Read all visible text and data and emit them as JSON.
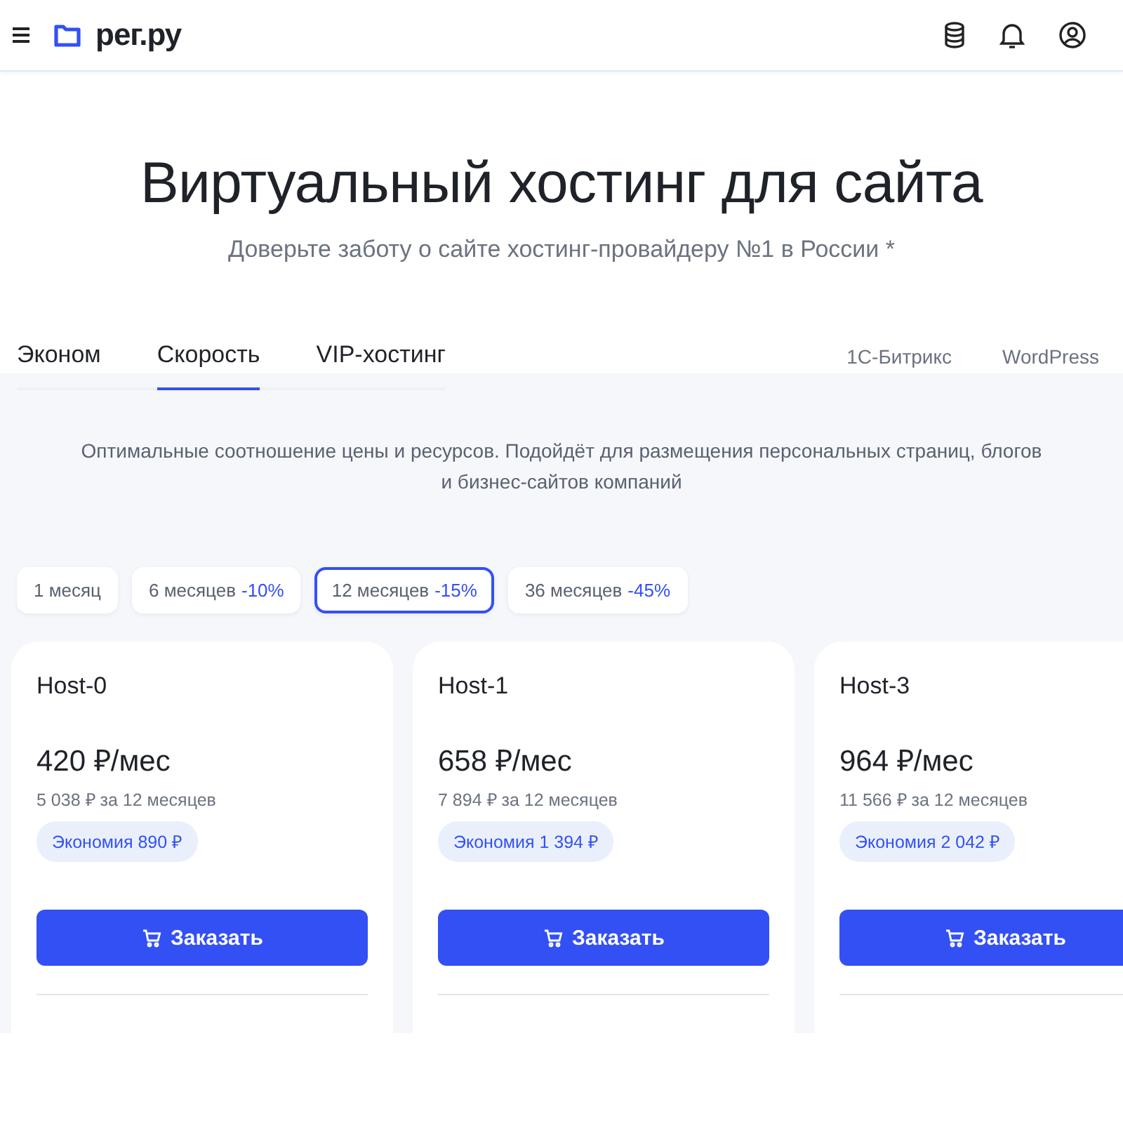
{
  "header": {
    "logo": "рег.ру"
  },
  "hero": {
    "title": "Виртуальный хостинг для сайта",
    "subtitle": "Доверьте заботу о сайте хостинг-провайдеру №1 в России *"
  },
  "tabs": [
    {
      "label": "Эконом",
      "selected": false
    },
    {
      "label": "Скорость",
      "selected": true
    },
    {
      "label": "VIP-хостинг",
      "selected": false
    }
  ],
  "side_links": [
    "1С-Битрикс",
    "WordPress"
  ],
  "description": [
    "Оптимальные соотношение цены и ресурсов. Подойдёт для размещения персональных страниц, блогов",
    "и бизнес-сайтов компаний"
  ],
  "periods": [
    {
      "label": "1 месяц",
      "selected": false
    },
    {
      "label": "6 месяцев",
      "discount": "-10%",
      "selected": false
    },
    {
      "label": "12 месяцев",
      "discount": "-15%",
      "selected": true
    },
    {
      "label": "36 месяцев",
      "discount": "-45%",
      "selected": false
    }
  ],
  "plans": [
    {
      "name": "Host-0",
      "price": "420 ₽/мес",
      "total": "5 038 ₽ за 12 месяцев",
      "saving": "Экономия 890 ₽",
      "button": "Заказать"
    },
    {
      "name": "Host-1",
      "price": "658 ₽/мес",
      "total": "7 894 ₽ за 12 месяцев",
      "saving": "Экономия 1 394 ₽",
      "button": "Заказать"
    },
    {
      "name": "Host-3",
      "price": "964 ₽/мес",
      "total": "11 566 ₽ за 12 месяцев",
      "saving": "Экономия 2 042 ₽",
      "button": "Заказать"
    }
  ]
}
